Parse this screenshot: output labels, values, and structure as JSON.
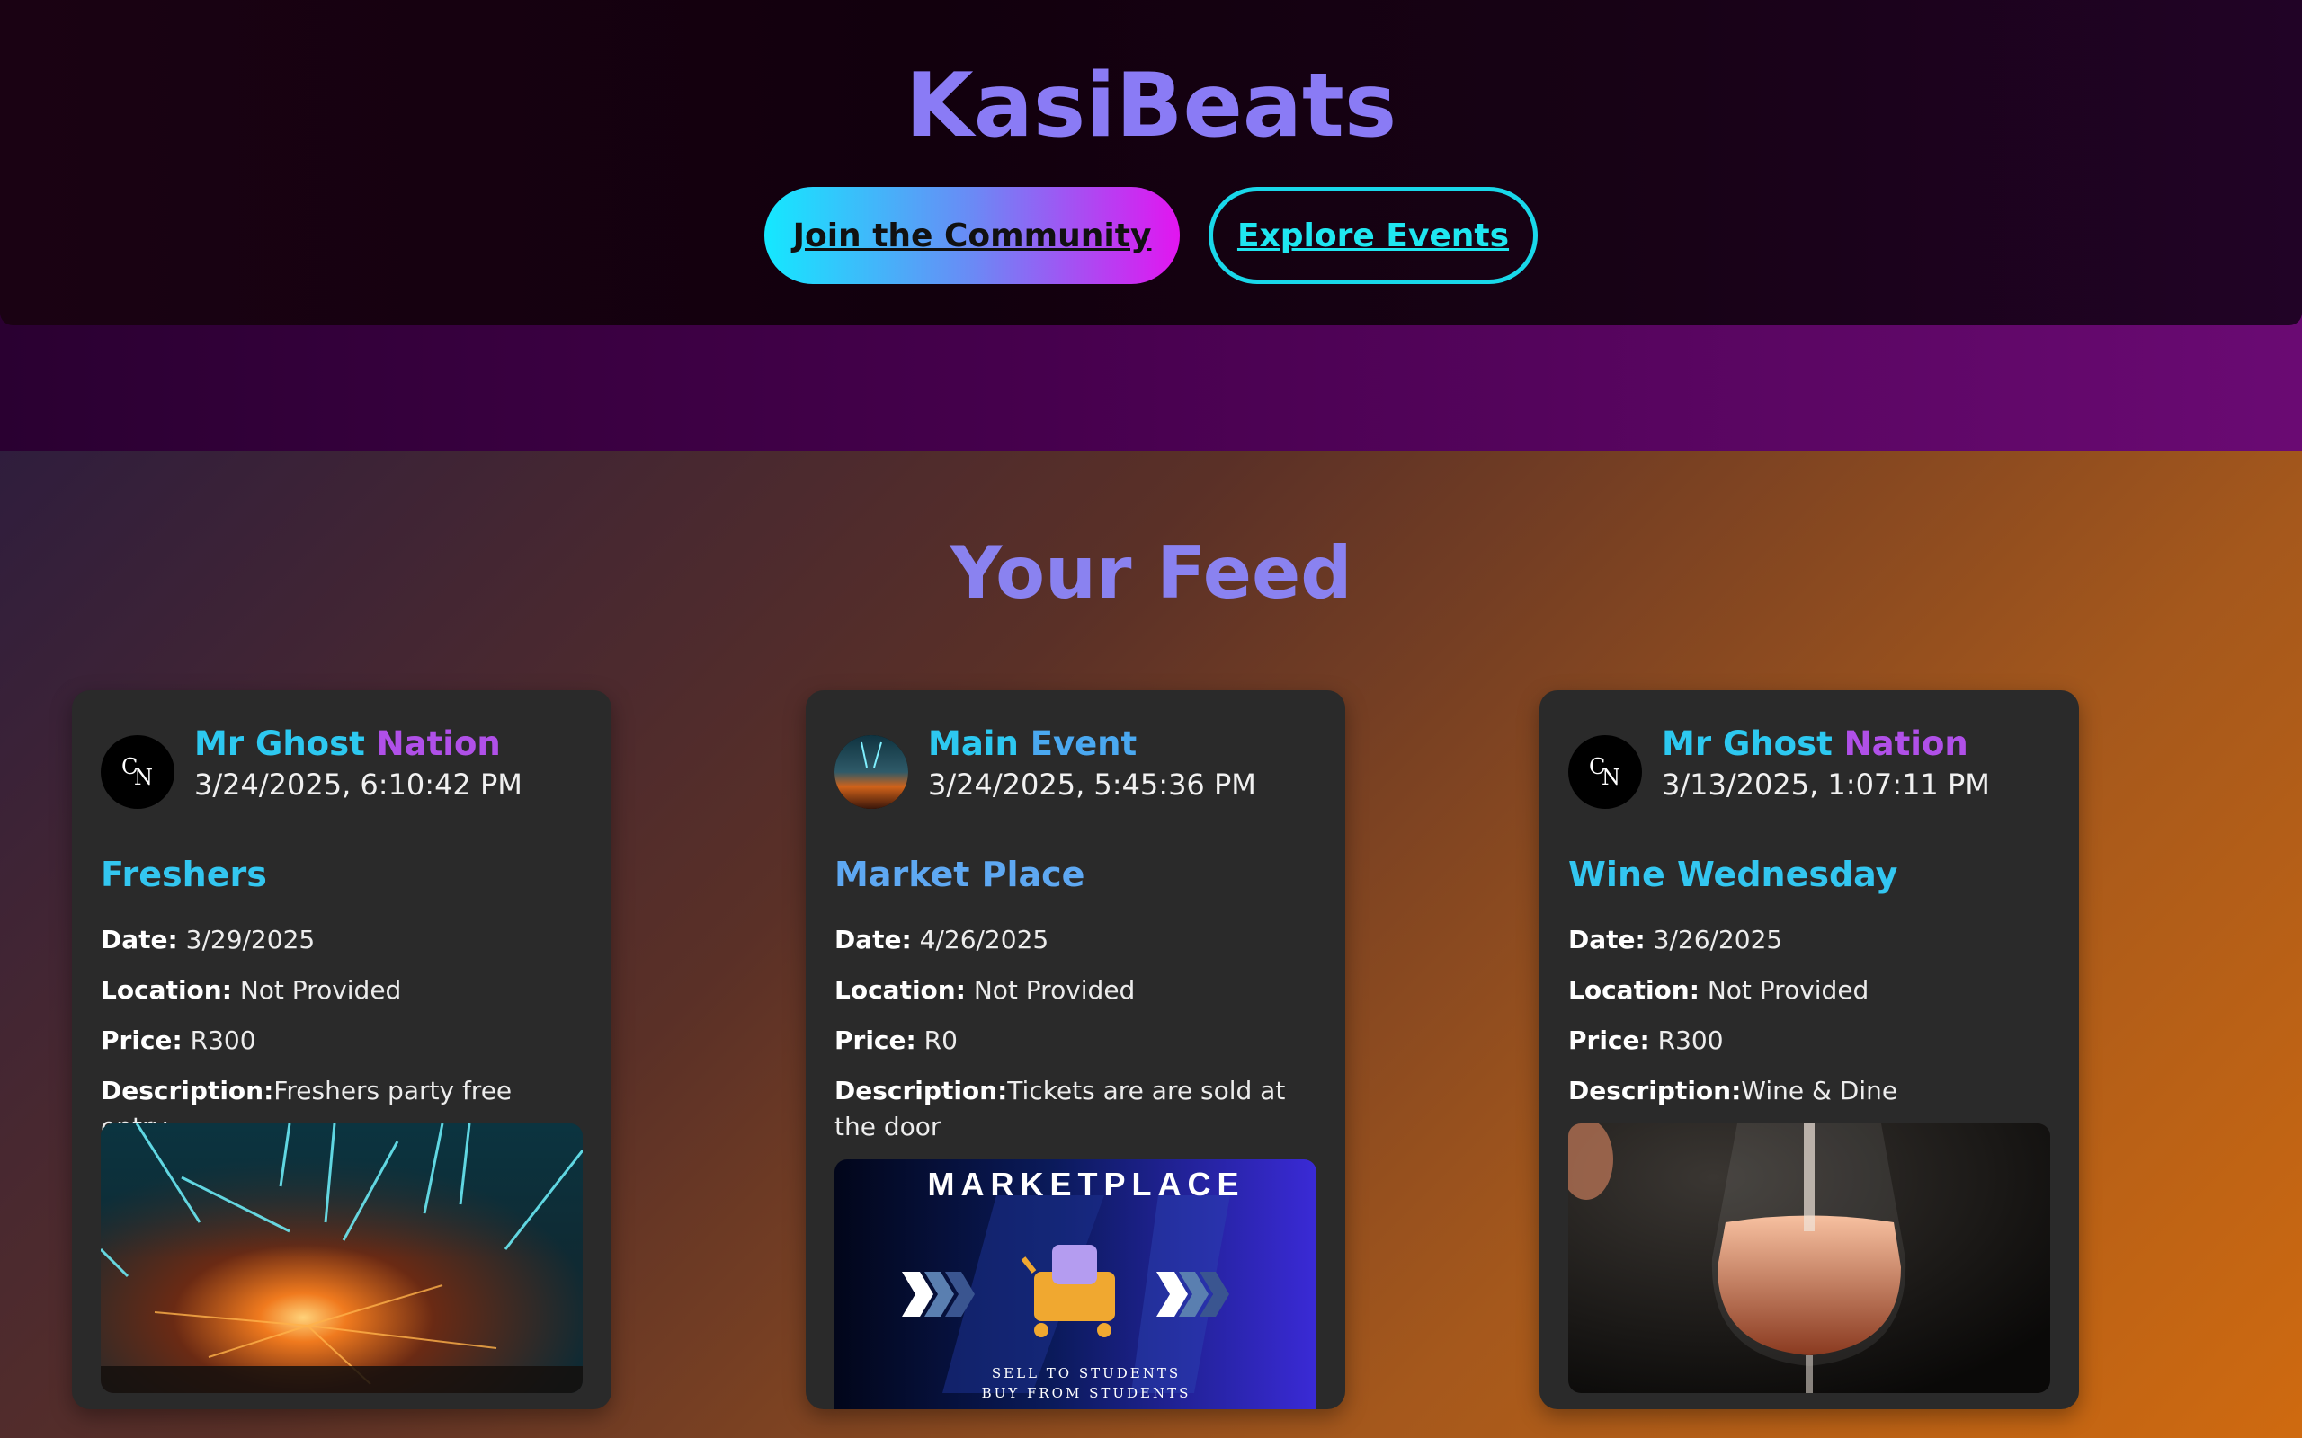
{
  "app": {
    "brand": "KasiBeats",
    "cta": {
      "join_label": "Join the Community",
      "explore_label": "Explore Events"
    },
    "feed_title": "Your Feed",
    "colors": {
      "accent_cyan": "#19d8ea",
      "accent_magenta": "#e215f0",
      "brand_purple": "#8a7bf5",
      "card_bg": "#2a2a2a"
    }
  },
  "feed": [
    {
      "author_first": "Mr Ghost",
      "author_last": " Nation",
      "avatar_icon": "gn-monogram-icon",
      "timestamp": "3/24/2025, 6:10:42 PM",
      "title": "Freshers",
      "date_label": "Date:",
      "date": "3/29/2025",
      "location_label": "Location:",
      "location": "Not Provided",
      "price_label": "Price:",
      "price": "R300",
      "description_label": "Description:",
      "description": "Freshers party free entry",
      "image_icon": "concert-lasers-photo"
    },
    {
      "author_first": "Main",
      "author_last": " Event",
      "avatar_icon": "sunset-avatar-icon",
      "timestamp": "3/24/2025, 5:45:36 PM",
      "title": "Market Place",
      "date_label": "Date:",
      "date": "4/26/2025",
      "location_label": "Location:",
      "location": "Not Provided",
      "price_label": "Price:",
      "price": "R0",
      "description_label": "Description:",
      "description": "Tickets are are sold at the door",
      "image_icon": "marketplace-banner",
      "image_text": {
        "headline": "MARKETPLACE",
        "line1": "SELL TO STUDENTS",
        "line2": "BUY FROM STUDENTS"
      }
    },
    {
      "author_first": "Mr Ghost",
      "author_last": " Nation",
      "avatar_icon": "gn-monogram-icon",
      "timestamp": "3/13/2025, 1:07:11 PM",
      "title": "Wine Wednesday",
      "date_label": "Date:",
      "date": "3/26/2025",
      "location_label": "Location:",
      "location": "Not Provided",
      "price_label": "Price:",
      "price": "R300",
      "description_label": "Description:",
      "description": "Wine & Dine",
      "image_icon": "wine-glass-photo"
    }
  ]
}
